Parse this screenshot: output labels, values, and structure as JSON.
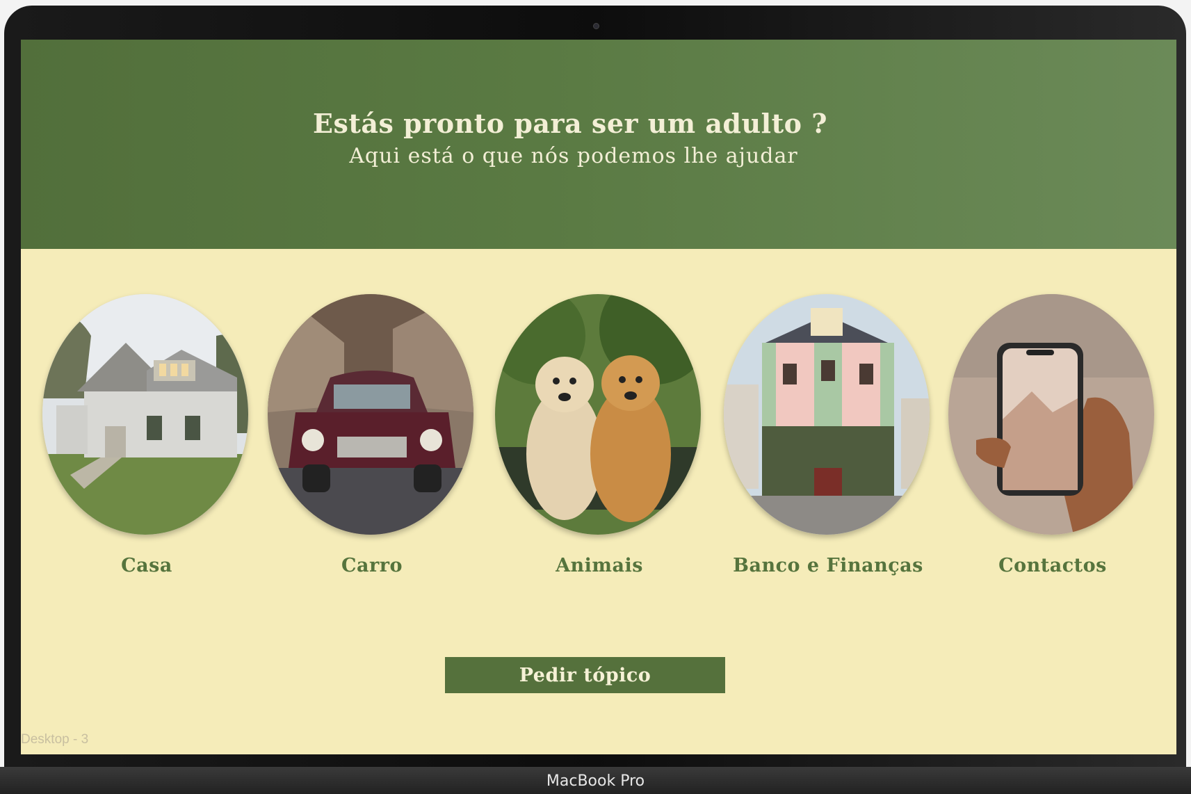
{
  "hero": {
    "title": "Estás pronto para ser um adulto ?",
    "subtitle": "Aqui está o que nós podemos lhe ajudar"
  },
  "topics": [
    {
      "label": "Casa",
      "icon": "house-image"
    },
    {
      "label": "Carro",
      "icon": "car-image"
    },
    {
      "label": "Animais",
      "icon": "dogs-image"
    },
    {
      "label": "Banco e Finanças",
      "icon": "bank-image"
    },
    {
      "label": "Contactos",
      "icon": "phone-image"
    }
  ],
  "cta": {
    "label": "Pedir tópico"
  },
  "frame": {
    "label": "Desktop - 3"
  },
  "device": {
    "model": "MacBook Pro"
  },
  "colors": {
    "header_green": "#5a7a43",
    "background_cream": "#f5ecb9",
    "label_green": "#56743d",
    "button_green": "#55713c"
  }
}
